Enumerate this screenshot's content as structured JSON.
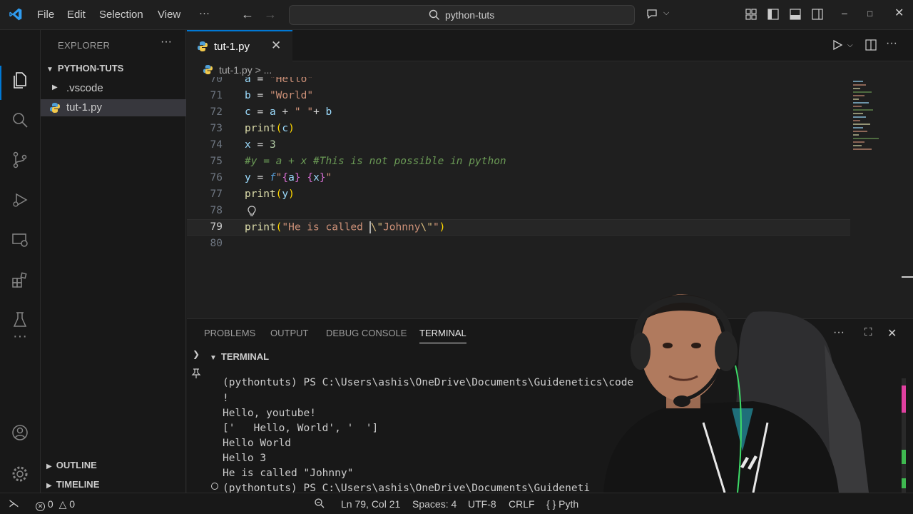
{
  "titlebar": {
    "menu": [
      "File",
      "Edit",
      "Selection",
      "View",
      "···"
    ],
    "search": "python-tuts"
  },
  "sidebar": {
    "title": "EXPLORER",
    "more": "···",
    "folder": "PYTHON-TUTS",
    "items": [
      {
        "label": ".vscode"
      },
      {
        "label": "tut-1.py"
      }
    ],
    "outline": "OUTLINE",
    "timeline": "TIMELINE"
  },
  "editor": {
    "tab_label": "tut-1.py",
    "breadcrumb": "tut-1.py > ...",
    "line_numbers": [
      "70",
      "71",
      "72",
      "73",
      "74",
      "75",
      "76",
      "77",
      "78",
      "79",
      "80"
    ]
  },
  "panel": {
    "tabs": [
      "PROBLEMS",
      "OUTPUT",
      "DEBUG CONSOLE",
      "TERMINAL"
    ],
    "section": "TERMINAL",
    "lines": [
      "(pythontuts) PS C:\\Users\\ashis\\OneDrive\\Documents\\Guidenetics\\code",
      "!",
      "Hello, youtube!",
      "['   Hello, World', '  ']",
      "Hello World",
      "Hello 3",
      "He is called \"Johnny\"",
      "(pythontuts) PS C:\\Users\\ashis\\OneDrive\\Documents\\Guideneti"
    ]
  },
  "statusbar": {
    "errors": "0",
    "warnings": "0",
    "position": "Ln 79, Col 21",
    "spaces": "Spaces: 4",
    "encoding": "UTF-8",
    "eol": "CRLF",
    "lang": "{ }  Pyth"
  },
  "colors": {
    "accent": "#0078d4",
    "background": "#1f1f1f"
  }
}
